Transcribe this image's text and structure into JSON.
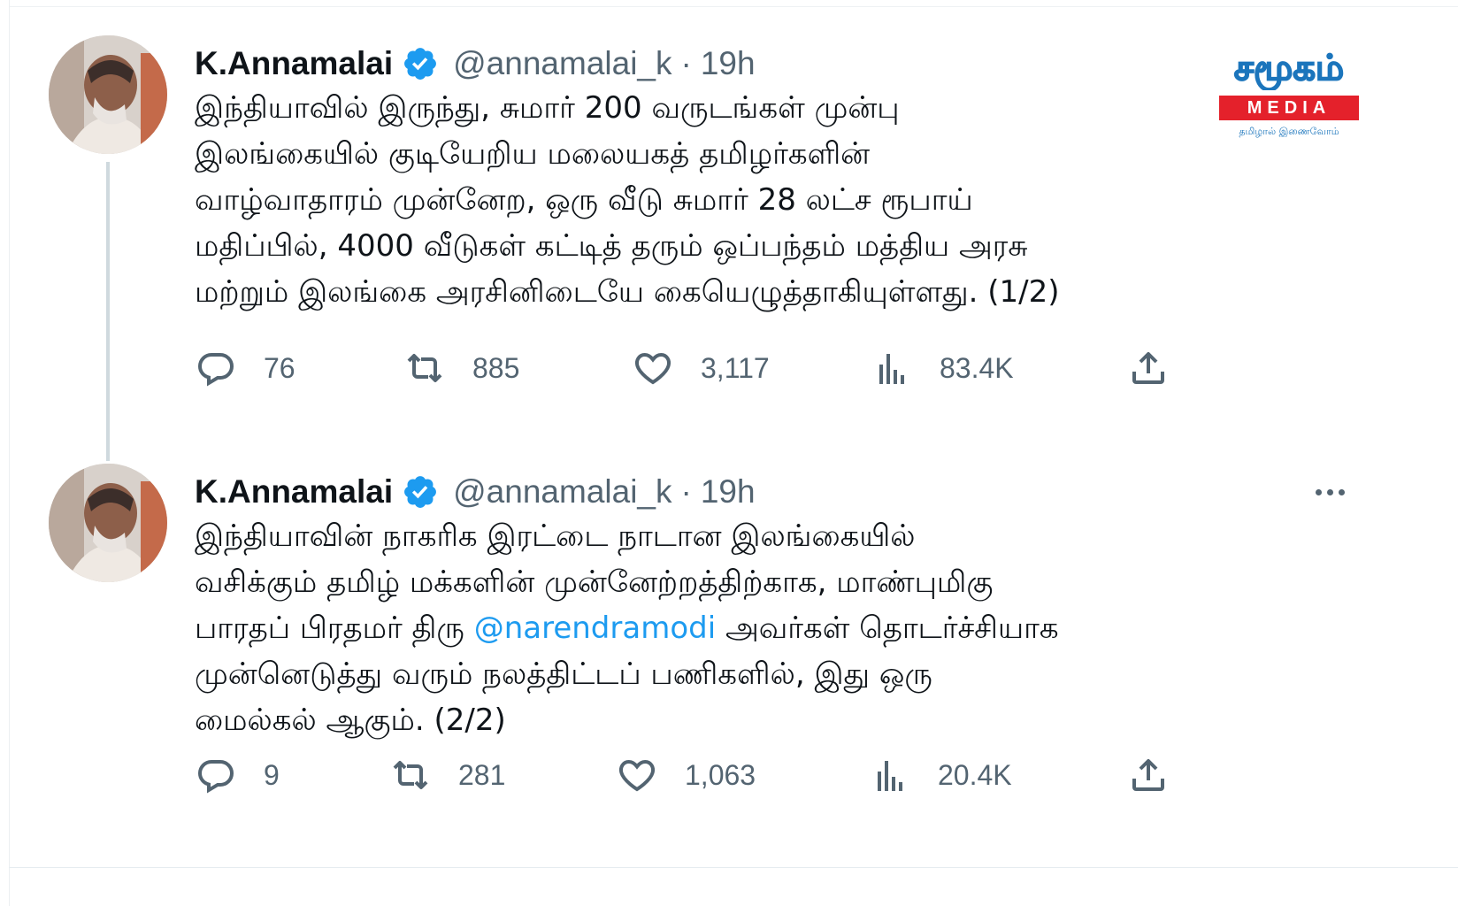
{
  "colors": {
    "accent": "#1d9bf0",
    "text_primary": "#0f1419",
    "text_secondary": "#536471",
    "logo_blue": "#1b75bc",
    "logo_red": "#e4212b"
  },
  "watermark": {
    "brand_tamil": "சமூகம்",
    "brand_word": "MEDIA",
    "tagline": "தமிழால் இணைவோம்"
  },
  "tweets": [
    {
      "author_name": "K.Annamalai",
      "verified_icon": "verified-badge-icon",
      "handle": "@annamalai_k",
      "separator": "·",
      "time": "19h",
      "text_lines": [
        "இந்தியாவில் இருந்து, சுமார் 200 வருடங்கள் முன்பு",
        "இலங்கையில் குடியேறிய மலையகத் தமிழர்களின்",
        "வாழ்வாதாரம் முன்னேற, ஒரு வீடு சுமார் 28 லட்ச ரூபாய்",
        "மதிப்பில், 4000 வீடுகள் கட்டித் தரும் ஒப்பந்தம் மத்திய அரசு",
        "மற்றும் இலங்கை அரசினிடையே கையெழுத்தாகியுள்ளது. (1/2)"
      ],
      "stats": {
        "replies": "76",
        "retweets": "885",
        "likes": "3,117",
        "views": "83.4K"
      }
    },
    {
      "author_name": "K.Annamalai",
      "verified_icon": "verified-badge-icon",
      "handle": "@annamalai_k",
      "separator": "·",
      "time": "19h",
      "text_lines": [
        "இந்தியாவின் நாகரிக இரட்டை நாடான இலங்கையில்",
        "வசிக்கும் தமிழ் மக்களின் முன்னேற்றத்திற்காக, மாண்புமிகு"
      ],
      "line3_before": "பாரதப் பிரதமர் திரு ",
      "line3_mention": "@narendramodi",
      "line3_after": " அவர்கள் தொடர்ச்சியாக",
      "text_lines_end": [
        "முன்னெடுத்து வரும் நலத்திட்டப் பணிகளில், இது ஒரு",
        "மைல்கல் ஆகும். (2/2)"
      ],
      "stats": {
        "replies": "9",
        "retweets": "281",
        "likes": "1,063",
        "views": "20.4K"
      }
    }
  ]
}
